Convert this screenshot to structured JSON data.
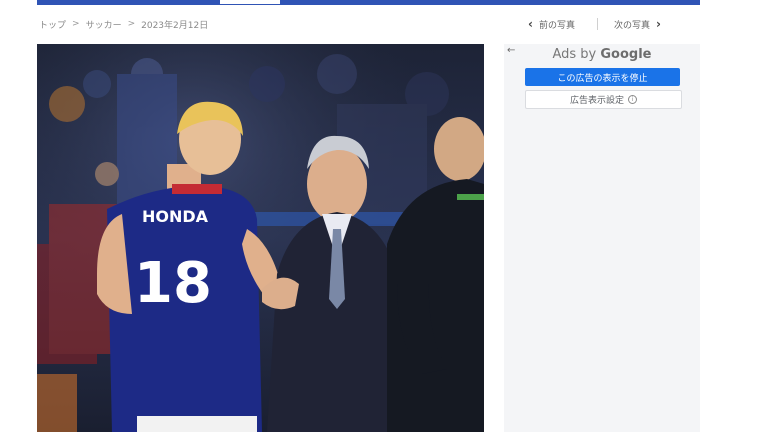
{
  "breadcrumb": {
    "items": [
      "トップ",
      "サッカー",
      "2023年2月12日"
    ],
    "separator": ">"
  },
  "photo_nav": {
    "prev_label": "前の写真",
    "next_label": "次の写真",
    "prev_icon": "chevron-left-icon",
    "next_icon": "chevron-right-icon"
  },
  "photo": {
    "jersey_name": "HONDA",
    "jersey_number": "18"
  },
  "ad_panel": {
    "back_arrow": "←",
    "ads_by": "Ads by ",
    "brand": "Google",
    "stop_button": "この広告の表示を停止",
    "settings_button": "広告表示設定",
    "info_icon_glyph": "i"
  },
  "colors": {
    "top_bar": "#2f54b5",
    "ad_primary_button": "#1a73e8",
    "ad_panel_bg": "#f4f5f7"
  }
}
